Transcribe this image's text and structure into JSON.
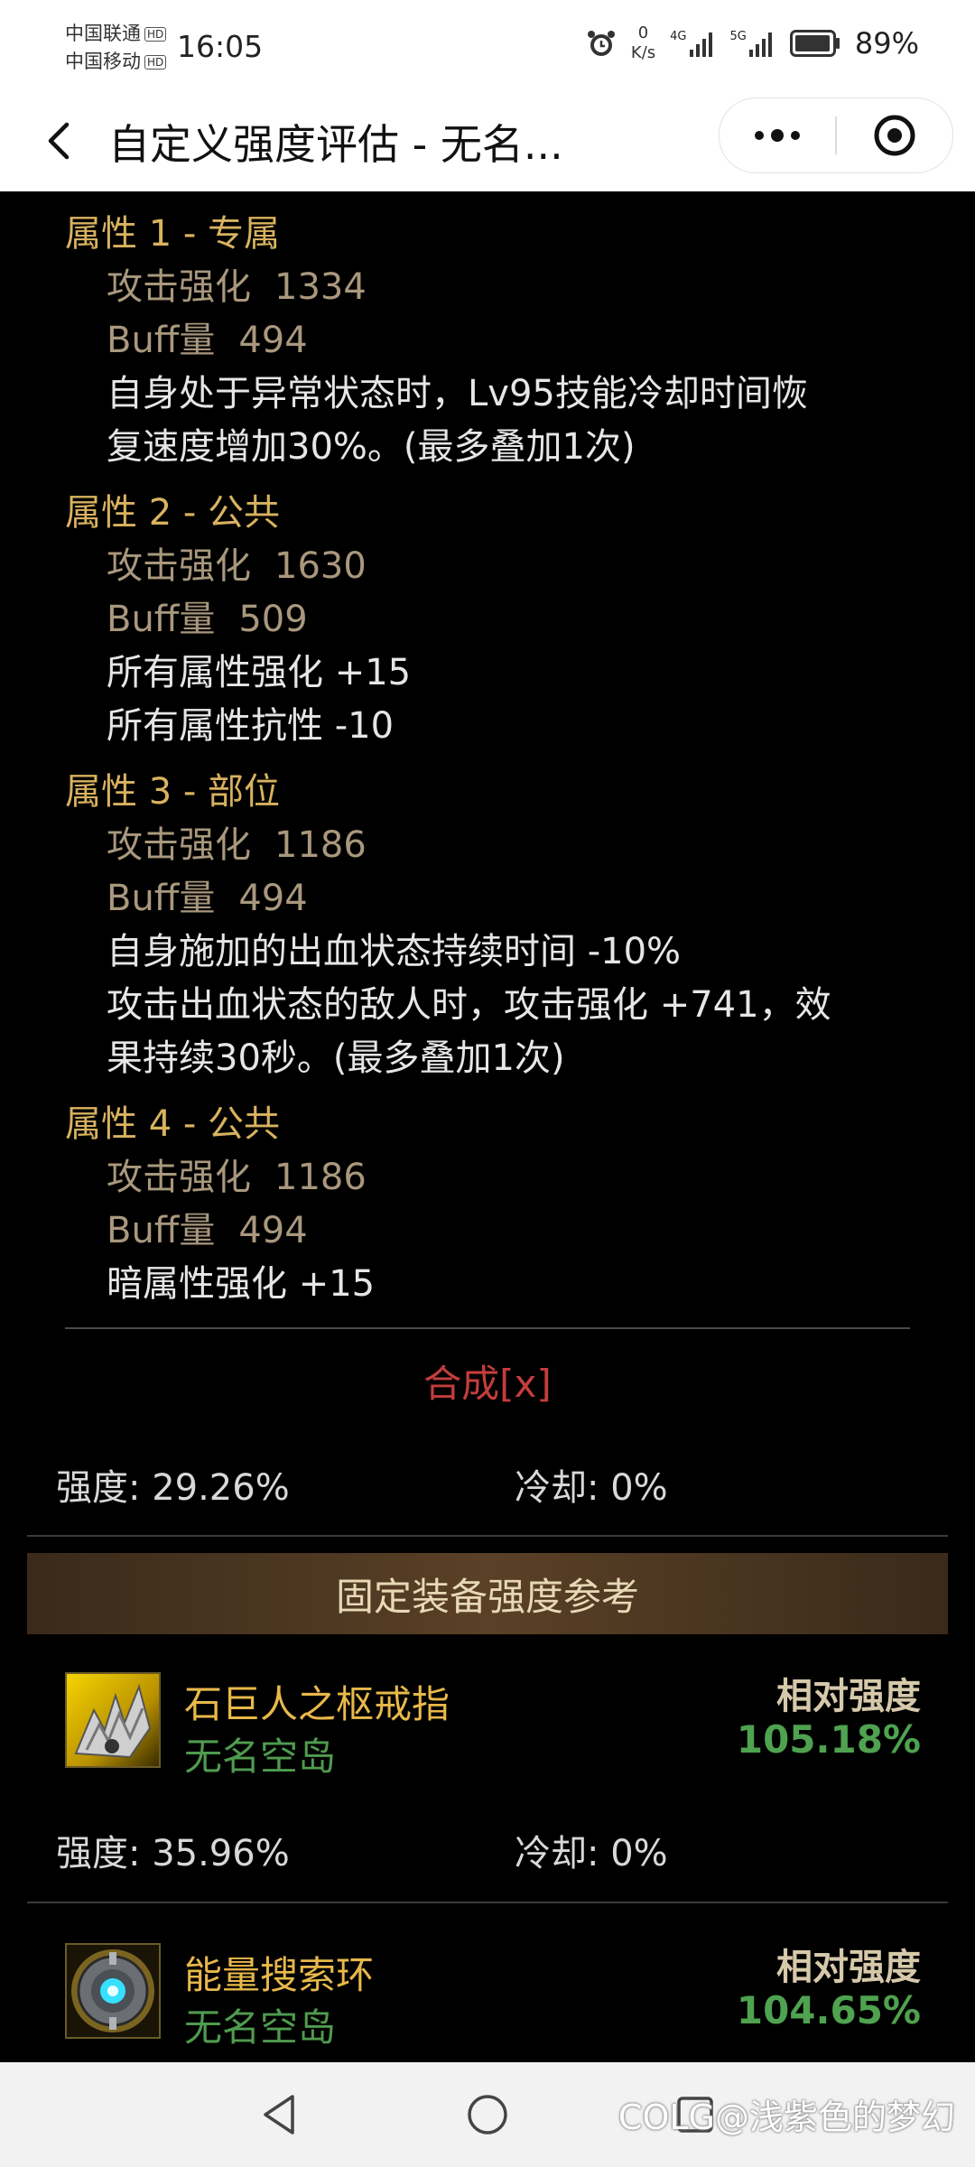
{
  "status_bar": {
    "carrier1": "中国联通",
    "carrier2": "中国移动",
    "hd": "HD",
    "time": "16:05",
    "net_speed_value": "0",
    "net_speed_unit": "K/s",
    "net1": "4G",
    "net2": "5G",
    "battery": "89%"
  },
  "title_bar": {
    "title": "自定义强度评估 - 无名..."
  },
  "properties": [
    {
      "head": "属性 1 - 专属",
      "attack_label": "攻击强化",
      "attack_value": "1334",
      "buff_label": "Buff量",
      "buff_value": "494",
      "effects": [
        "自身处于异常状态时，Lv95技能冷却时间恢",
        "复速度增加30%。(最多叠加1次)"
      ]
    },
    {
      "head": "属性 2 - 公共",
      "attack_label": "攻击强化",
      "attack_value": "1630",
      "buff_label": "Buff量",
      "buff_value": "509",
      "effects": [
        "所有属性强化 +15",
        "所有属性抗性 -10"
      ]
    },
    {
      "head": "属性 3 - 部位",
      "attack_label": "攻击强化",
      "attack_value": "1186",
      "buff_label": "Buff量",
      "buff_value": "494",
      "effects": [
        "自身施加的出血状态持续时间 -10%",
        "攻击出血状态的敌人时，攻击强化 +741，效",
        "果持续30秒。(最多叠加1次)"
      ]
    },
    {
      "head": "属性 4 - 公共",
      "attack_label": "攻击强化",
      "attack_value": "1186",
      "buff_label": "Buff量",
      "buff_value": "494",
      "effects": [
        "暗属性强化 +15"
      ]
    }
  ],
  "synth_label": "合成[x]",
  "summary": {
    "strength": "强度: 29.26%",
    "cooldown": "冷却: 0%"
  },
  "section_title": "固定装备强度参考",
  "items": [
    {
      "name": "石巨人之枢戒指",
      "source": "无名空岛",
      "rel_label": "相对强度",
      "rel_value": "105.18%",
      "strength": "强度: 35.96%",
      "cooldown": "冷却: 0%",
      "icon": "ring-claw-icon"
    },
    {
      "name": "能量搜索环",
      "source": "无名空岛",
      "rel_label": "相对强度",
      "rel_value": "104.65%",
      "icon": "energy-ring-icon"
    }
  ],
  "watermark": "@浅紫色的梦幻",
  "watermark_logo": "COLG",
  "colors": {
    "gold": "#d8b25f",
    "stat": "#a9987d",
    "green": "#4fa24f",
    "red": "#c43d3d"
  }
}
